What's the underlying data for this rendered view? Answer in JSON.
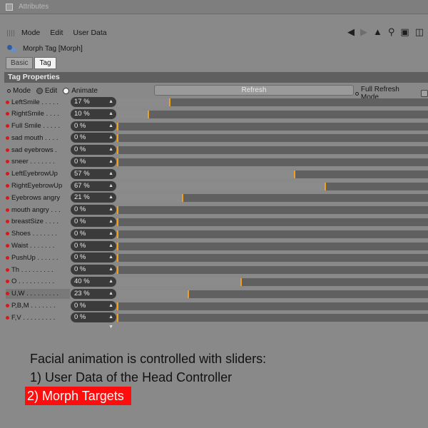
{
  "window": {
    "title": "Attributes"
  },
  "menu": {
    "items": [
      "Mode",
      "Edit",
      "User Data"
    ]
  },
  "toolbar": {
    "icons": [
      "back-arrow-icon",
      "forward-arrow-icon",
      "cursor-icon",
      "search-icon",
      "lock-icon",
      "dock-icon"
    ]
  },
  "object": {
    "name": "Morph Tag [Morph]"
  },
  "tabs": [
    {
      "label": "Basic",
      "active": false
    },
    {
      "label": "Tag",
      "active": true
    }
  ],
  "section": {
    "title": "Tag Properties"
  },
  "mode": {
    "label": "Mode",
    "options": [
      "Edit",
      "Animate"
    ],
    "selected": "Animate",
    "refresh_label": "Refresh",
    "full_refresh_label": "Full Refresh Mode"
  },
  "morphs": [
    {
      "label": "LeftSmile",
      "dots": " . . . . .",
      "value": "17 %",
      "percent": 17
    },
    {
      "label": "RightSmile",
      "dots": " . . . .",
      "value": "10 %",
      "percent": 10
    },
    {
      "label": "Full Smile",
      "dots": " . . . . .",
      "value": "0 %",
      "percent": 0
    },
    {
      "label": "sad mouth",
      "dots": " . . . .",
      "value": "0 %",
      "percent": 0
    },
    {
      "label": "sad eyebrows",
      "dots": " .",
      "value": "0 %",
      "percent": 0
    },
    {
      "label": "sneer",
      "dots": " . . . . . . .",
      "value": "0 %",
      "percent": 0
    },
    {
      "label": "LeftEyebrowUp",
      "dots": "",
      "value": "57 %",
      "percent": 57
    },
    {
      "label": "RightEyebrowUp",
      "dots": "",
      "value": "67 %",
      "percent": 67
    },
    {
      "label": "Eyebrows angry",
      "dots": "",
      "value": "21 %",
      "percent": 21
    },
    {
      "label": "mouth angry",
      "dots": " . . .",
      "value": "0 %",
      "percent": 0
    },
    {
      "label": "breastSize",
      "dots": " . . . .",
      "value": "0 %",
      "percent": 0
    },
    {
      "label": "Shoes",
      "dots": " . . . . . . .",
      "value": "0 %",
      "percent": 0
    },
    {
      "label": "Waist",
      "dots": " . . . . . . .",
      "value": "0 %",
      "percent": 0
    },
    {
      "label": "PushUp",
      "dots": " . . . . . .",
      "value": "0 %",
      "percent": 0
    },
    {
      "label": "Th",
      "dots": " . . . . . . . . .",
      "value": "0 %",
      "percent": 0
    },
    {
      "label": "O",
      "dots": " . . . . . . . . . .",
      "value": "40 %",
      "percent": 40
    },
    {
      "label": "U,W",
      "dots": " . . . . . . . . .",
      "value": "23 %",
      "percent": 23,
      "highlight": true
    },
    {
      "label": "P,B,M",
      "dots": " . . . . . . .",
      "value": "0 %",
      "percent": 0
    },
    {
      "label": "F,V",
      "dots": " . . . . . . . . .",
      "value": "0 %",
      "percent": 0
    }
  ],
  "caption": {
    "line1": "Facial animation is controlled with sliders:",
    "line2": "1) User Data of the Head Controller",
    "line3": "2) Morph Targets"
  },
  "colors": {
    "accent_knob": "#f0a020",
    "highlight_box": "#ff0d0d",
    "morph_dot": "#d41a1a"
  }
}
